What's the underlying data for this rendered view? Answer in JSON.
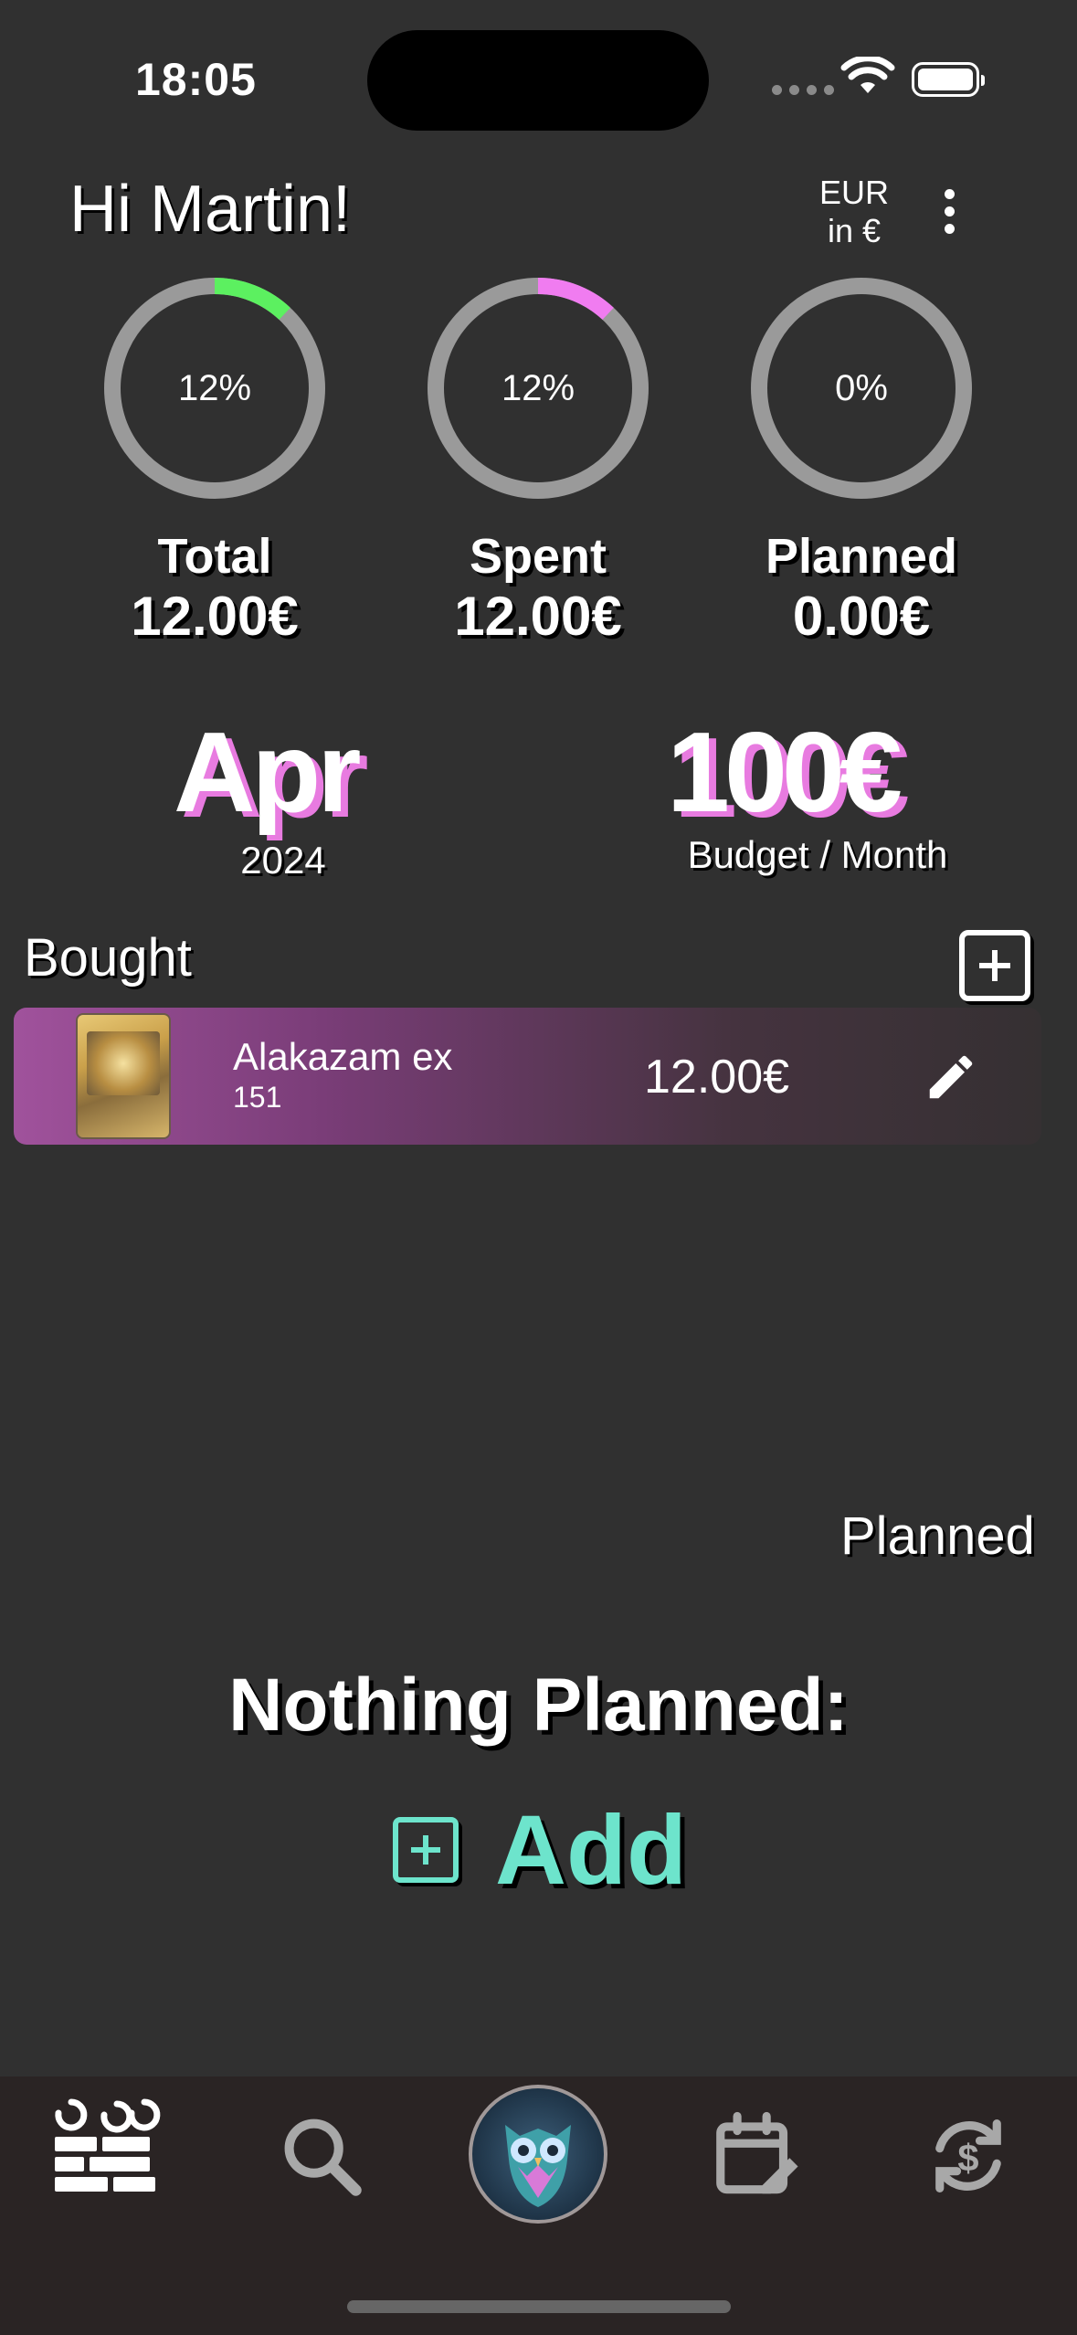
{
  "status_bar": {
    "time": "18:05"
  },
  "header": {
    "greeting": "Hi Martin!",
    "currency_line1": "EUR",
    "currency_line2": "in €"
  },
  "stats": [
    {
      "label": "Total",
      "value": "12.00€",
      "percent_text": "12%",
      "percent": 12,
      "color": "#5cf060"
    },
    {
      "label": "Spent",
      "value": "12.00€",
      "percent_text": "12%",
      "percent": 12,
      "color": "#f07cf0"
    },
    {
      "label": "Planned",
      "value": "0.00€",
      "percent_text": "0%",
      "percent": 0,
      "color": "#9a9a9a"
    }
  ],
  "period": {
    "month": "Apr",
    "year": "2024"
  },
  "budget": {
    "amount": "100€",
    "label": "Budget / Month"
  },
  "bought": {
    "title": "Bought",
    "items": [
      {
        "name": "Alakazam ex",
        "set": "151",
        "price": "12.00€"
      }
    ]
  },
  "planned": {
    "title": "Planned",
    "empty_text": "Nothing Planned:",
    "add_label": "Add"
  },
  "tabbar": {
    "items": [
      "collection-icon",
      "search-icon",
      "owl-logo",
      "calendar-edit-icon",
      "currency-exchange-icon"
    ]
  }
}
